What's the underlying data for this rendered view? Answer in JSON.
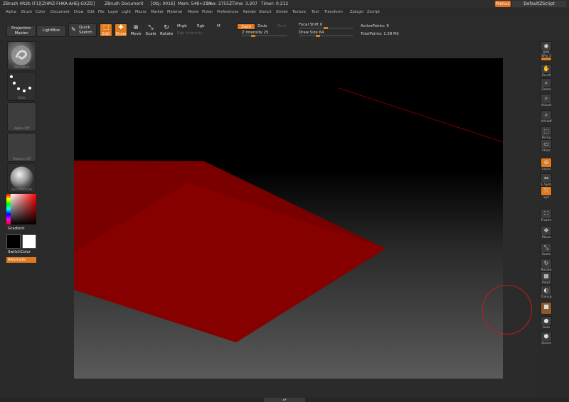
{
  "window": {
    "title": "ZBrush 4R2b (F1)[ZHMZ-FHKA-AHEJ-GXZD]",
    "document": "ZBrush Document",
    "stats": [
      "[Obj: 0016]",
      "Mem: 548+214",
      "Free: 3755",
      "ZTime: 3.207",
      "Timer: 0.212"
    ],
    "menus_label": "Menus",
    "script_label": "DefaultZScript"
  },
  "menubar": [
    "Alpha",
    "Brush",
    "Color",
    "Document",
    "Draw",
    "Edit",
    "File",
    "Layer",
    "Light",
    "Macro",
    "Marker",
    "Material",
    "Movie",
    "Picker",
    "Preferences",
    "Render",
    "Stencil",
    "Stroke",
    "Texture",
    "Tool",
    "Transform",
    "Zplugin",
    "Zscript"
  ],
  "toolbar": {
    "projection_master": "Projection Master",
    "lightbox": "LightBox",
    "quick_sketch": "Quick Sketch",
    "edit": "Edit",
    "draw": "Draw",
    "move": "Move",
    "scale": "Scale",
    "rotate": "Rotate",
    "mrgb": "Mrgb",
    "rgb": "Rgb",
    "m": "M",
    "rgb_intensity": "Rgb Intensity",
    "zadd": "Zadd",
    "zsub": "Zsub",
    "zcut": "Zcut",
    "z_intensity": "Z Intensity 25",
    "focal_shift": "Focal Shift 0",
    "draw_size": "Draw Size 64",
    "active_points": "ActivePoints: 9",
    "total_points": "TotalPoints: 1.58 Mil",
    "z_intensity_level": 0.25,
    "focal_shift_level": 0.5,
    "draw_size_level": 0.36
  },
  "left_shelf": {
    "brush_label": "Standard",
    "stroke_label": "Dots",
    "alpha_label": "Alpha Off",
    "texture_label": "Texture Off",
    "material_label": "SkinMaterial",
    "gradient_label": "Gradient",
    "switchcolor_label": "SwitchColor",
    "alternate_label": "Alternate"
  },
  "right_shelf": [
    {
      "name": "bpr",
      "label": "BPR",
      "icon": "render-sphere-icon"
    },
    {
      "name": "spix",
      "label": "SPix 3",
      "icon": "spix-slider-icon"
    },
    {
      "name": "scroll",
      "label": "Scroll",
      "icon": "hand-icon"
    },
    {
      "name": "zoom",
      "label": "Zoom",
      "icon": "magnifier-icon"
    },
    {
      "name": "actual",
      "label": "Actual",
      "icon": "magnifier-icon"
    },
    {
      "name": "aahalf",
      "label": "AAHalf",
      "icon": "magnifier-icon"
    },
    {
      "name": "persp",
      "label": "Persp",
      "icon": "perspective-icon"
    },
    {
      "name": "floor",
      "label": "Floor",
      "icon": "floor-icon"
    },
    {
      "name": "local",
      "label": "Local",
      "icon": "local-icon"
    },
    {
      "name": "lsym",
      "label": "L.Sym",
      "icon": "symmetry-icon"
    },
    {
      "name": "xyz",
      "label": "xyz",
      "icon": "axis-icon"
    },
    {
      "name": "frame",
      "label": "Frame",
      "icon": "frame-icon"
    },
    {
      "name": "move",
      "label": "Move",
      "icon": "move-icon"
    },
    {
      "name": "scale",
      "label": "Scale",
      "icon": "scale-icon"
    },
    {
      "name": "rotate",
      "label": "Rotate",
      "icon": "rotate-icon"
    },
    {
      "name": "polyf",
      "label": "PolyF",
      "icon": "polyframe-icon"
    },
    {
      "name": "transp",
      "label": "Transp",
      "icon": "transparency-icon"
    },
    {
      "name": "ghost",
      "label": "",
      "icon": "ghost-icon"
    },
    {
      "name": "solo",
      "label": "Solo",
      "icon": "solo-icon"
    },
    {
      "name": "xpose",
      "label": "Xpose",
      "icon": "xpose-icon"
    }
  ]
}
